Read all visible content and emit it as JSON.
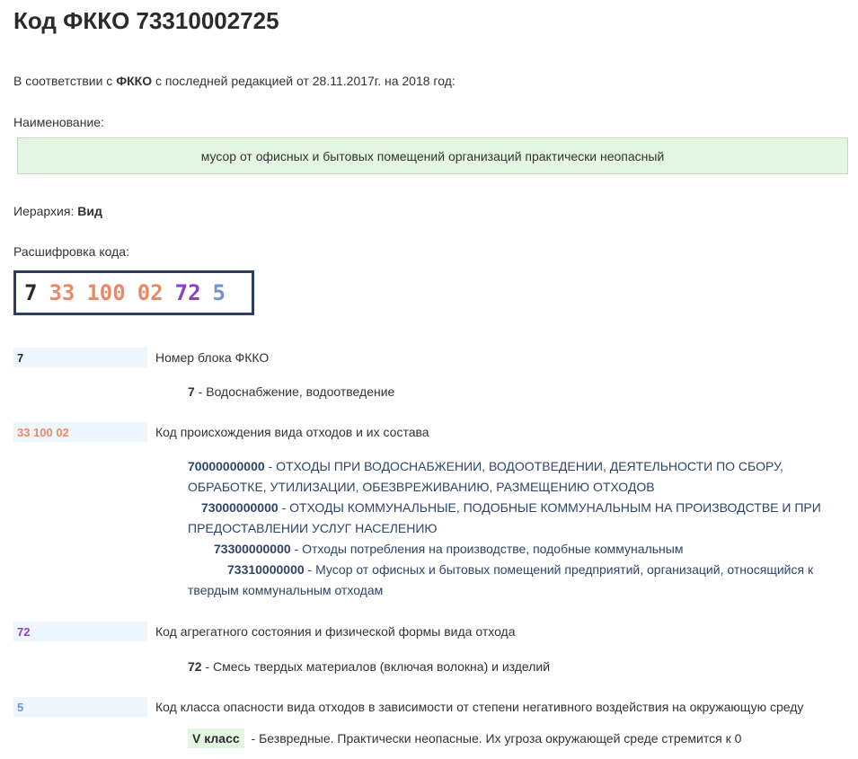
{
  "title": "Код ФККО 73310002725",
  "intro": {
    "prefix": "В соответствии с ",
    "bold": "ФККО",
    "suffix": " с последней редакцией от 28.11.2017г. на 2018 год:"
  },
  "name_label": "Наименование:",
  "name_value": "мусор от офисных и бытовых помещений организаций практически неопасный",
  "hierarchy": {
    "label": "Иерархия: ",
    "value": "Вид"
  },
  "decode_label": "Расшифровка кода:",
  "code_parts": {
    "block": "7",
    "origin_1": "33",
    "origin_2": "100",
    "origin_3": "02",
    "aggregate": "72",
    "hazard": "5"
  },
  "colors": {
    "block": "#2b2b2b",
    "origin": "#e98a66",
    "aggregate": "#8a3fcf",
    "hazard": "#6f93d3",
    "hierarchy_text": "#2f4468",
    "name_box_bg": "#e3f6e1",
    "segment_bg": "#eef6fd"
  },
  "sections": {
    "block": {
      "code": "7",
      "title": "Номер блока ФККО",
      "detail_code": "7",
      "detail_text": " - Водоснабжение, водоотведение"
    },
    "origin": {
      "code": "33 100 02",
      "title": "Код происхождения вида отходов и их состава",
      "items": [
        {
          "code": "70000000000",
          "text": " - ОТХОДЫ ПРИ ВОДОСНАБЖЕНИИ, ВОДООТВЕДЕНИИ, ДЕЯТЕЛЬНОСТИ ПО СБОРУ, ОБРАБОТКЕ, УТИЛИЗАЦИИ, ОБЕЗВРЕЖИВАНИЮ, РАЗМЕЩЕНИЮ ОТХОДОВ"
        },
        {
          "code": "73000000000",
          "text": " - ОТХОДЫ КОММУНАЛЬНЫЕ, ПОДОБНЫЕ КОММУНАЛЬНЫМ НА ПРОИЗВОДСТВЕ И ПРИ ПРЕДОСТАВЛЕНИИ УСЛУГ НАСЕЛЕНИЮ"
        },
        {
          "code": "73300000000",
          "text": " - Отходы потребления на производстве, подобные коммунальным"
        },
        {
          "code": "73310000000",
          "text": " - Мусор от офисных и бытовых помещений предприятий, организаций, относящийся к твердым коммунальным отходам"
        }
      ]
    },
    "aggregate": {
      "code": "72",
      "title": "Код агрегатного состояния и физической формы вида отхода",
      "detail_code": "72",
      "detail_text": " - Смесь твердых материалов (включая волокна) и изделий"
    },
    "hazard": {
      "code": "5",
      "title": "Код класса опасности вида отходов в зависимости от степени негативного воздействия на окружающую среду",
      "badge": "V класс",
      "detail_text": " - Безвредные. Практически неопасные. Их угроза окружающей среде стремится к 0"
    }
  }
}
